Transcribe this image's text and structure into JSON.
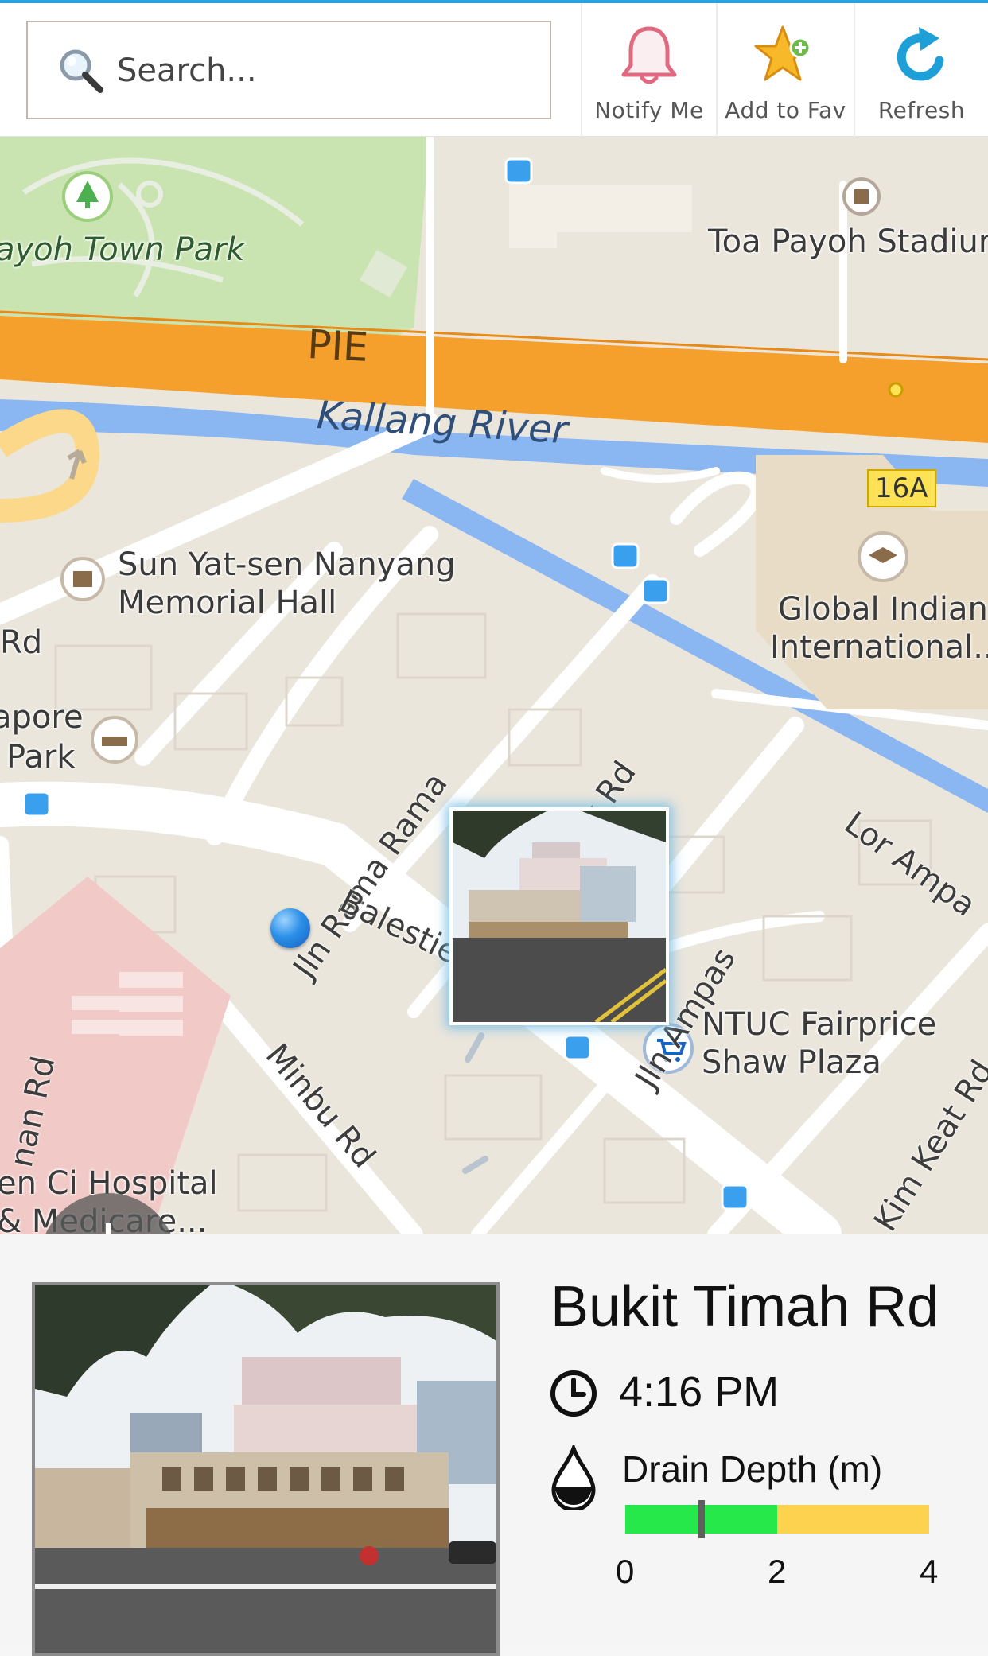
{
  "toolbar": {
    "search_placeholder": "Search...",
    "notify_label": "Notify Me",
    "fav_label": "Add to Fav",
    "refresh_label": "Refresh",
    "icons": [
      "search-icon",
      "bell-icon",
      "star-plus-icon",
      "refresh-icon"
    ]
  },
  "map": {
    "park_label": "ayoh Town Park",
    "stadium_label": "Toa Payoh Stadiur",
    "highway_label": "PIE",
    "exit_label": "16A",
    "river_label": "Kallang River",
    "memorial_label_1": "Sun Yat-sen Nanyang",
    "memorial_label_2": "Memorial Hall",
    "school_label_1": "Global Indian",
    "school_label_2": "International...",
    "hotel_label_1": "apore",
    "hotel_label_2": "Park",
    "rd_left": "Rd",
    "jln_rama": "Jln Rama Rama",
    "k_rd": "k Rd",
    "balestier": "Balestier Rd",
    "jln_ampas": "Jln Ampas",
    "lor_ampas": "Lor Ampa",
    "minbu": "Minbu Rd",
    "nan_rd": "nan Rd",
    "kim_keat": "Kim Keat Rd",
    "ntuc_1": "NTUC Fairprice",
    "ntuc_2": "Shaw Plaza",
    "hospital_1": "en Ci Hospital",
    "hospital_2": "& Medicare...",
    "colors": {
      "park": "#c9e3b1",
      "highway": "#f5a02c",
      "river": "#8ab6f2",
      "land": "#ebe6dc",
      "hospital": "#f1c9c6"
    }
  },
  "info": {
    "road_name": "Bukit Timah Rd",
    "time": "4:16 PM",
    "depth_title": "Drain Depth (m)",
    "depth_value": 1.0,
    "depth_max": 4,
    "green_until": 2,
    "ticks": [
      "0",
      "2",
      "4"
    ],
    "colors": {
      "safe": "#27e84a",
      "warning": "#fdd24f"
    }
  }
}
